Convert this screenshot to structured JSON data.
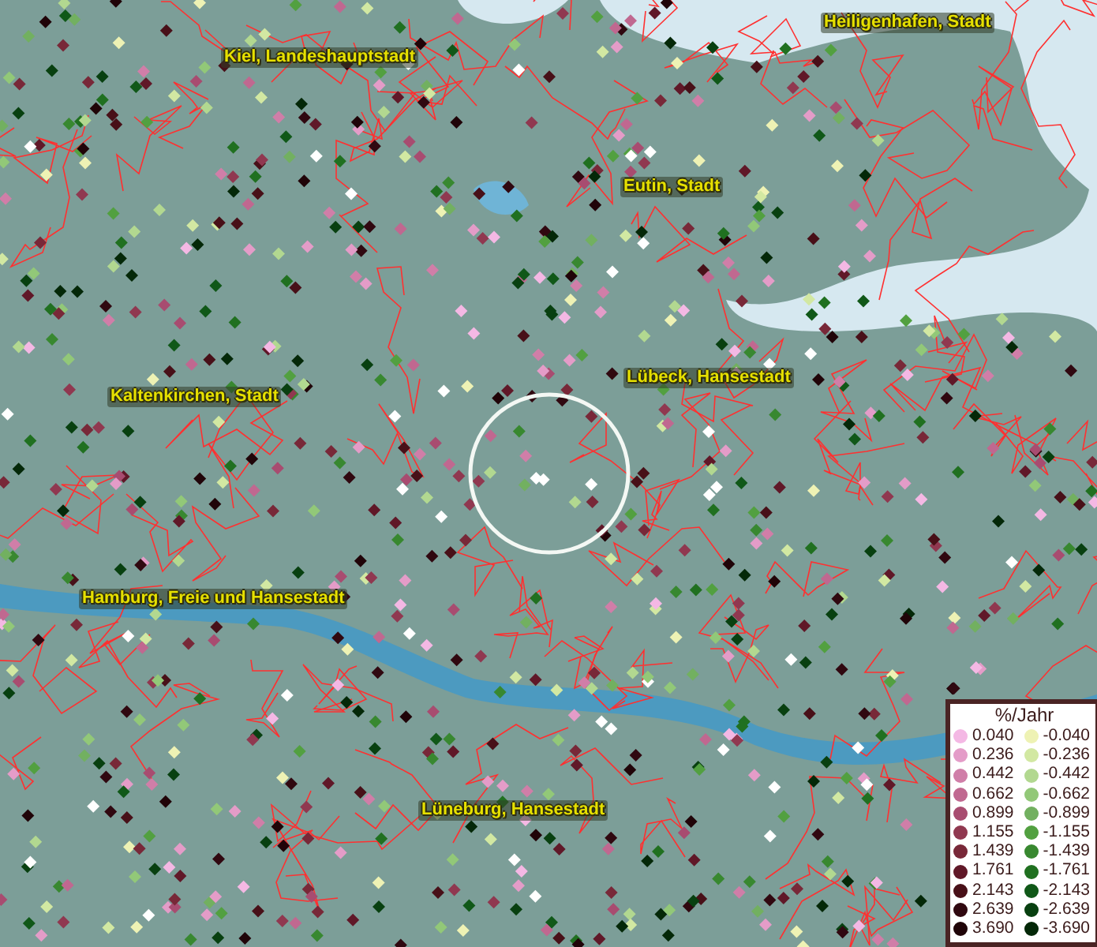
{
  "map": {
    "places": [
      {
        "name": "Kiel, Landeshauptstadt"
      },
      {
        "name": "Heiligenhafen, Stadt"
      },
      {
        "name": "Eutin, Stadt"
      },
      {
        "name": "Kaltenkirchen, Stadt"
      },
      {
        "name": "Lübeck, Hansestadt"
      },
      {
        "name": "Hamburg, Freie und Hansestadt"
      },
      {
        "name": "Lüneburg, Hansestadt"
      }
    ]
  },
  "legend": {
    "title": "%/Jahr",
    "rows": [
      {
        "increase": {
          "label": "0.040",
          "color": "#f4b8e4"
        },
        "decrease": {
          "label": "-0.040",
          "color": "#eef2b4"
        }
      },
      {
        "increase": {
          "label": "0.236",
          "color": "#e49cc8"
        },
        "decrease": {
          "label": "-0.236",
          "color": "#d2e8a2"
        }
      },
      {
        "increase": {
          "label": "0.442",
          "color": "#d07ea8"
        },
        "decrease": {
          "label": "-0.442",
          "color": "#b2d890"
        }
      },
      {
        "increase": {
          "label": "0.662",
          "color": "#c06890"
        },
        "decrease": {
          "label": "-0.662",
          "color": "#92c878"
        }
      },
      {
        "increase": {
          "label": "0.899",
          "color": "#a84c70"
        },
        "decrease": {
          "label": "-0.899",
          "color": "#72b060"
        }
      },
      {
        "increase": {
          "label": "1.155",
          "color": "#903850"
        },
        "decrease": {
          "label": "-1.155",
          "color": "#52a040"
        }
      },
      {
        "increase": {
          "label": "1.439",
          "color": "#782838"
        },
        "decrease": {
          "label": "-1.439",
          "color": "#388830"
        }
      },
      {
        "increase": {
          "label": "1.761",
          "color": "#601828"
        },
        "decrease": {
          "label": "-1.761",
          "color": "#207020"
        }
      },
      {
        "increase": {
          "label": "2.143",
          "color": "#481018"
        },
        "decrease": {
          "label": "-2.143",
          "color": "#105818"
        }
      },
      {
        "increase": {
          "label": "2.639",
          "color": "#300810"
        },
        "decrease": {
          "label": "-2.639",
          "color": "#084010"
        }
      },
      {
        "increase": {
          "label": "3.690",
          "color": "#200408"
        },
        "decrease": {
          "label": "-3.690",
          "color": "#042808"
        }
      }
    ]
  }
}
